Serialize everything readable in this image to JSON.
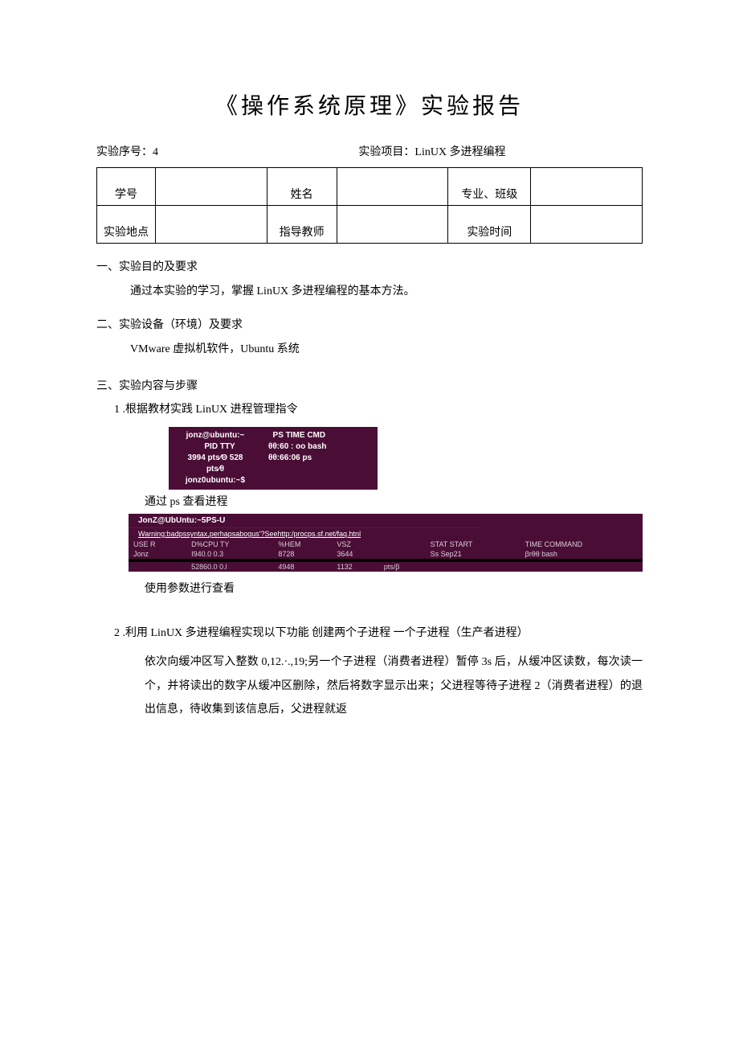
{
  "title": "《操作系统原理》实验报告",
  "meta": {
    "num_label": "实验序号：",
    "num_value": "4",
    "proj_label": "实验项目：",
    "proj_value": "LinUX 多进程编程"
  },
  "table": {
    "r1c1": "学号",
    "r1c2": "",
    "r1c3": "姓名",
    "r1c4": "",
    "r1c5": "专业、班级",
    "r1c6": "",
    "r2c1": "实验地点",
    "r2c2": "",
    "r2c3": "指导教师",
    "r2c4": "",
    "r2c5": "实验时间",
    "r2c6": ""
  },
  "s1": {
    "h": "一、实验目的及要求",
    "p": "通过本实验的学习，掌握 LinUX 多进程编程的基本方法。"
  },
  "s2": {
    "h": "二、实验设备（环境）及要求",
    "p": "VMware 虚拟机软件，Ubuntu 系统"
  },
  "s3": {
    "h": "三、实验内容与步骤",
    "step1": "1 .根据教材实践 LinUX 进程管理指令",
    "cap1": "通过 ps 查看进程",
    "cap2": "使用参数进行查看",
    "step2_lead": "2 .利用 LinUX 多进程编程实现以下功能 创建两个子进程 一个子进程（生产者进程）",
    "step2_body": "依次向缓冲区写入整数 0,12.·.,19;另一个子进程（消费者进程）暂停 3s 后，从缓冲区读数，每次读一个，并将读出的数字从缓冲区删除，然后将数字显示出来；父进程等待子进程 2（消费者进程）的退出信息，待收集到该信息后，父进程就返"
  },
  "term1": {
    "left": "jonz@ubuntu:~\n    PID TTY\n3994 pts∕Θ 528\npts∕θ\njonz0ubuntu:~$",
    "right": "  PS TIME CMD\nθθ:60 : oo bash\nθθ:66:06 ps\n"
  },
  "term2": {
    "header": "JonZ@UbUntu:~5PS-U",
    "warn": "Warning:badpssyntax,perhapsabogus'?Seehttp:/procps.sf.net/faq.htnl",
    "row_h": [
      "USE R",
      "D%CPU TY",
      "%HEM",
      "VSZ",
      "",
      "STAT START",
      "TIME COMMAND"
    ],
    "row_1": [
      "Jonz",
      "I940.0  0.3",
      "8728",
      "3644",
      "",
      "Ss Sep21",
      "βrθθ bash"
    ],
    "row_2": [
      "",
      "52860.0   0.l",
      "4948",
      "1132",
      "pts/β",
      "",
      ""
    ]
  }
}
